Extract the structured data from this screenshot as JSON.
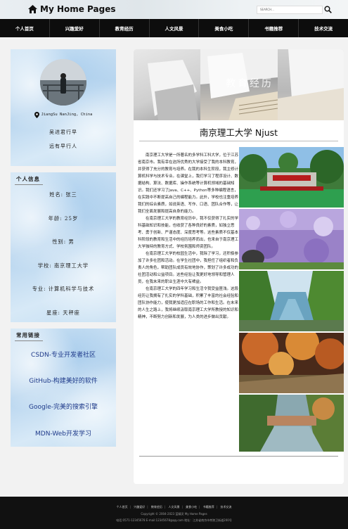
{
  "header": {
    "brand": "My Home Pages",
    "search_placeholder": "SEARCH..."
  },
  "nav": {
    "items": [
      "个人首页",
      "兴趣爱好",
      "教育经历",
      "人文风景",
      "美食小吃",
      "书籍推荐",
      "技术交流"
    ]
  },
  "profile": {
    "location": "JiangSu NanJing, China",
    "motto_1": "吴进君行早",
    "motto_2": "远有早行人"
  },
  "info": {
    "title": "个人信息",
    "rows": [
      "姓名: 张三",
      "年龄: 25岁",
      "性别: 男",
      "学校: 南京理工大学",
      "专业: 计算机科学与技术",
      "星座: 天秤座"
    ]
  },
  "links": {
    "title": "常用链接",
    "items": [
      "CSDN-专业开发者社区",
      "GitHub-构建美好的软件",
      "Google-完美的搜索引擎",
      "MDN-Web开发学习"
    ]
  },
  "article": {
    "banner_text": "教育经历",
    "title": "南京理工大学 Njust",
    "paragraphs": [
      "南京理工大学是一所著名的多学科工科大学，位于江苏省南京市。我有幸在这所优秀的大学接受了我的本科教育，并获得了充分的教育与培养。在我的本科生阶段，我主修计算机科学与技术专业。在课堂上，我们学习了程序设计、数据结构、算法、数据库、操作系统等计算机领域的基础知识。我们还学习了Java、C++、Python等多种编程语言，在实践中不断提高自己的编程能力。此外，学校也注重培养我们的综合素质，如说英语、写作、口语、团队合作等，让我们全面发展和提高自身的能力。",
      "在南京理工大学的教育经历中，我不仅获得了扎实的学科基础知识和技能，也收获了各种良好的素质，如独立思考、勇于创新、严谨态度、深度思考等。这些素质不仅基本科阶段的教育和生活中的经历培养而出，也来自于南京理工大学独特的教育方式、学校氛围和师资团队。",
      "在南京理工大学的校园生活中，我除了学习，还积极参加了许多社团和活动。在学生社团中，我担任了组织者和负责人的角色，帮助团队成员有效地协作，策划了许多成功的社团活动和公益项目。这些经验让我更好地领导和管理人员，在我未来的职业生涯中大有裨益。",
      "在南京理工大学的四年学习和生活令我受益匪浅。这段经历让我拥有了扎实的学科基础，积累了丰富的社会经验和团队协作能力，使我更加适应在职场的工作和生活。在未来的人生之路上，我将继续汲取南京理工大学所教授的知识和精神，不断努力创新和发展，为人类的进步做出贡献。"
    ]
  },
  "footer": {
    "links": [
      "个人首页",
      "兴趣爱好",
      "教育经历",
      "人文风景",
      "美食小吃",
      "书籍推荐",
      "技术交流"
    ],
    "copyright": "Copyright © 2004-2023 蓝精灵 My Home Pages",
    "contact": "电话:0571-12345678 E-mail:12345678@qq.com 地址：江苏省南京市孝陵卫街道200号"
  },
  "colors": {
    "nav_bg": "#0d0d0d",
    "footer_bg": "#111111",
    "link_color": "#1e3a8a",
    "card_blue": "#c4def2"
  }
}
